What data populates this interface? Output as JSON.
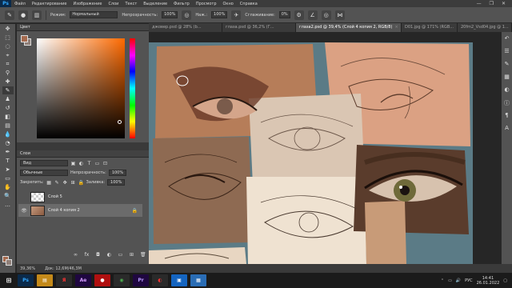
{
  "menubar": {
    "app_badge": "Ps",
    "items": [
      "Файл",
      "Редактирование",
      "Изображение",
      "Слои",
      "Текст",
      "Выделение",
      "Фильтр",
      "Просмотр",
      "Окно",
      "Справка"
    ],
    "window_controls": [
      "—",
      "❐",
      "✕"
    ]
  },
  "options": {
    "mode_label": "Режим:",
    "mode_value": "Нормальный",
    "opacity_label": "Непрозрачность:",
    "opacity_value": "100%",
    "pressure_label": "Наж.:",
    "pressure_value": "100%",
    "smoothing_label": "Сглаживание:",
    "smoothing_value": "0%"
  },
  "color_panel": {
    "tab": "Цвет",
    "foreground": "#a56a4e",
    "background": "#8f7f78"
  },
  "layers_panel": {
    "tab": "Слои",
    "filter_value": "Вид",
    "blend_value": "Обычные",
    "opacity_label": "Непрозрачность:",
    "opacity_value": "100%",
    "lock_label": "Закрепить:",
    "fill_label": "Заливка:",
    "fill_value": "100%",
    "layers": [
      {
        "name": "Слой 5",
        "visible": false,
        "selected": false,
        "locked": false
      },
      {
        "name": "Слой 4 копия 2",
        "visible": true,
        "selected": true,
        "locked": true
      }
    ],
    "footer_icons": [
      "link-icon",
      "fx-icon",
      "mask-icon",
      "adjustment-icon",
      "group-icon",
      "new-layer-icon",
      "trash-icon"
    ]
  },
  "documents": {
    "tabs": [
      {
        "label": "джовер.psd @ 28% (b...",
        "active": false
      },
      {
        "label": "глаза.psd @ 36,2% (Г...",
        "active": false
      },
      {
        "label": "глаза2.psd @ 39,4% (Слой 4 копия 2, RGB/8)",
        "active": true
      },
      {
        "label": "D01.jpg @ 171% (RGB...",
        "active": false
      },
      {
        "label": "20fm2_Vsd04.jpg @ 1...",
        "active": false
      }
    ]
  },
  "status": {
    "zoom": "39,36%",
    "doc_info": "Док: 12,6М/46,3М"
  },
  "taskbar": {
    "apps": [
      {
        "label": "Ps",
        "color": "#0b2a4a",
        "text_color": "#31a8ff"
      },
      {
        "label": "▤",
        "color": "#c48a1a",
        "text_color": "#fff"
      },
      {
        "label": "Я",
        "color": "#2a2a2a",
        "text_color": "#ff3333"
      },
      {
        "label": "Ae",
        "color": "#1f0740",
        "text_color": "#d59cff"
      },
      {
        "label": "●",
        "color": "#b01010",
        "text_color": "#fff"
      },
      {
        "label": "◉",
        "color": "#2a2a2a",
        "text_color": "#4caf50"
      },
      {
        "label": "Pr",
        "color": "#1f0740",
        "text_color": "#b99cff"
      },
      {
        "label": "◐",
        "color": "#2a2a2a",
        "text_color": "#ff3333"
      },
      {
        "label": "▣",
        "color": "#1565c0",
        "text_color": "#fff"
      },
      {
        "label": "▦",
        "color": "#2a6db5",
        "text_color": "#fff"
      }
    ],
    "lang": "РУС",
    "time": "14:41",
    "date": "26.01.2022"
  }
}
